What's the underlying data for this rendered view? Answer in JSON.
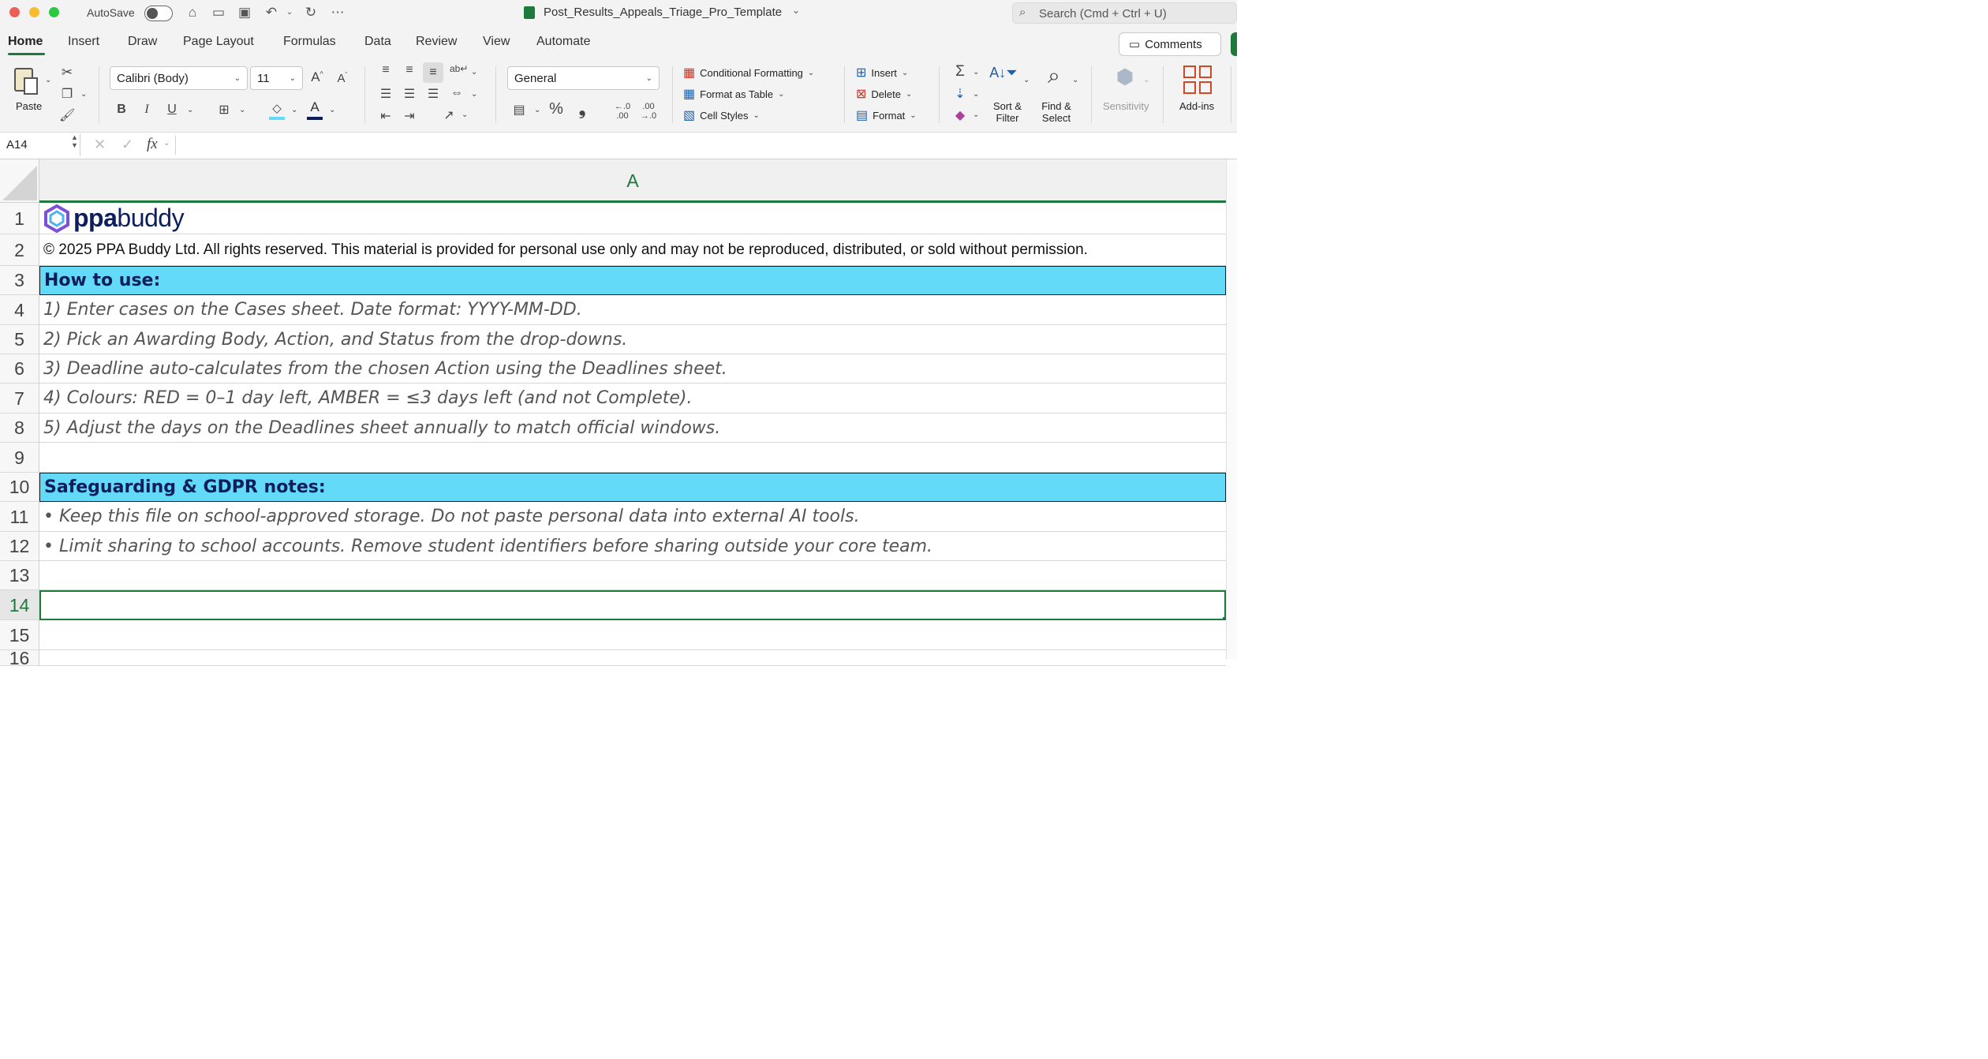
{
  "window": {
    "autosave_label": "AutoSave",
    "filename": "Post_Results_Appeals_Triage_Pro_Template",
    "search_placeholder": "Search (Cmd + Ctrl + U)"
  },
  "tabs": [
    "Home",
    "Insert",
    "Draw",
    "Page Layout",
    "Formulas",
    "Data",
    "Review",
    "View",
    "Automate"
  ],
  "active_tab": "Home",
  "comments_label": "Comments",
  "ribbon": {
    "paste_label": "Paste",
    "font_name": "Calibri (Body)",
    "font_size": "11",
    "bold": "B",
    "italic": "I",
    "underline": "U",
    "number_format": "General",
    "percent": "%",
    "comma": "❟",
    "conditional_formatting": "Conditional Formatting",
    "format_as_table": "Format as Table",
    "cell_styles": "Cell Styles",
    "insert": "Insert",
    "delete": "Delete",
    "format": "Format",
    "sort_filter_1": "Sort &",
    "sort_filter_2": "Filter",
    "find_select_1": "Find &",
    "find_select_2": "Select",
    "sensitivity": "Sensitivity",
    "addins": "Add-ins"
  },
  "formula_bar": {
    "name_box": "A14",
    "fx": "fx",
    "content": ""
  },
  "column_header": "A",
  "rows": [
    {
      "num": "1",
      "text": "",
      "style": "logo"
    },
    {
      "num": "2",
      "text": "© 2025 PPA Buddy Ltd. All rights reserved. This material is provided for personal use only and may not be reproduced, distributed, or sold without permission.",
      "style": "plain"
    },
    {
      "num": "3",
      "text": "How to use:",
      "style": "header"
    },
    {
      "num": "4",
      "text": "1) Enter cases on the Cases sheet. Date format: YYYY-MM-DD.",
      "style": "italic"
    },
    {
      "num": "5",
      "text": "2) Pick an Awarding Body, Action, and Status from the drop-downs.",
      "style": "italic"
    },
    {
      "num": "6",
      "text": "3) Deadline auto-calculates from the chosen Action using the Deadlines sheet.",
      "style": "italic"
    },
    {
      "num": "7",
      "text": "4) Colours: RED = 0–1 day left, AMBER = ≤3 days left (and not Complete).",
      "style": "italic"
    },
    {
      "num": "8",
      "text": "5) Adjust the days on the Deadlines sheet annually to match official windows.",
      "style": "italic"
    },
    {
      "num": "9",
      "text": "",
      "style": "plain"
    },
    {
      "num": "10",
      "text": "Safeguarding & GDPR notes:",
      "style": "header"
    },
    {
      "num": "11",
      "text": "• Keep this file on school-approved storage. Do not paste personal data into external AI tools.",
      "style": "italic"
    },
    {
      "num": "12",
      "text": "• Limit sharing to school accounts. Remove student identifiers before sharing outside your core team.",
      "style": "italic"
    },
    {
      "num": "13",
      "text": "",
      "style": "plain"
    },
    {
      "num": "14",
      "text": "",
      "style": "selected"
    },
    {
      "num": "15",
      "text": "",
      "style": "plain"
    },
    {
      "num": "16",
      "text": "",
      "style": "plain"
    }
  ],
  "logo": {
    "ppa": "ppa",
    "buddy": "buddy"
  },
  "colors": {
    "accent_green": "#1d7a3a",
    "header_fill": "#62daf8",
    "header_text": "#0e1e5a"
  }
}
